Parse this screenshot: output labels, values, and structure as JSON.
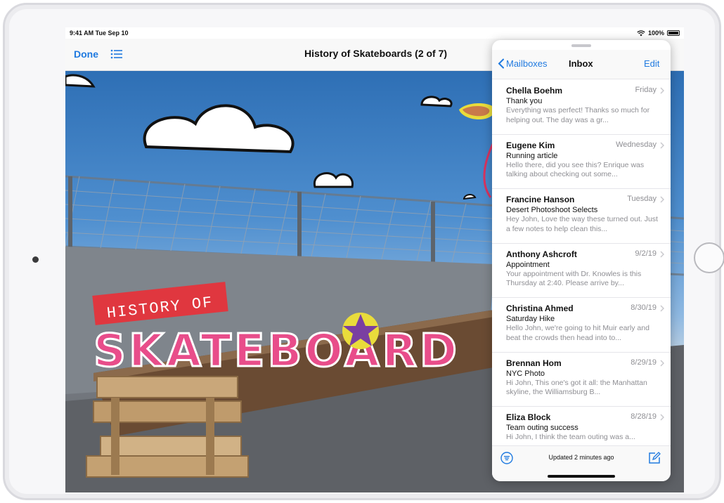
{
  "status_bar": {
    "time": "9:41 AM  Tue Sep 10",
    "battery": "100%"
  },
  "document": {
    "done_label": "Done",
    "title": "History of Skateboards (2 of 7)",
    "banner_line1": "HISTORY OF",
    "banner_line2": "SKATEBOARD"
  },
  "mail": {
    "back_label": "Mailboxes",
    "title": "Inbox",
    "edit_label": "Edit",
    "messages": [
      {
        "sender": "Chella Boehm",
        "date": "Friday",
        "subject": "Thank you",
        "preview": "Everything was perfect! Thanks so much for helping out. The day was a gr..."
      },
      {
        "sender": "Eugene Kim",
        "date": "Wednesday",
        "subject": "Running article",
        "preview": "Hello there, did you see this? Enrique was talking about checking out some..."
      },
      {
        "sender": "Francine Hanson",
        "date": "Tuesday",
        "subject": "Desert Photoshoot Selects",
        "preview": "Hey John, Love the way these turned out. Just a few notes to help clean this..."
      },
      {
        "sender": "Anthony Ashcroft",
        "date": "9/2/19",
        "subject": "Appointment",
        "preview": "Your appointment with Dr. Knowles is this Thursday at 2:40. Please arrive by..."
      },
      {
        "sender": "Christina Ahmed",
        "date": "8/30/19",
        "subject": "Saturday Hike",
        "preview": "Hello John, we're going to hit Muir early and beat the crowds then head into to..."
      },
      {
        "sender": "Brennan Hom",
        "date": "8/29/19",
        "subject": "NYC Photo",
        "preview": "Hi John, This one's got it all: the Manhattan skyline, the Williamsburg B..."
      },
      {
        "sender": "Eliza Block",
        "date": "8/28/19",
        "subject": "Team outing success",
        "preview": "Hi John, I think the team outing was a..."
      }
    ],
    "updated_text": "Updated 2 minutes ago"
  },
  "colors": {
    "accent": "#1f7ae0",
    "banner_red": "#e0373f",
    "sky": "#3c7dc2"
  },
  "icons": [
    "list-icon",
    "chevron-left-icon",
    "chevron-right-icon",
    "filter-icon",
    "compose-icon",
    "wifi-icon",
    "battery-icon"
  ]
}
